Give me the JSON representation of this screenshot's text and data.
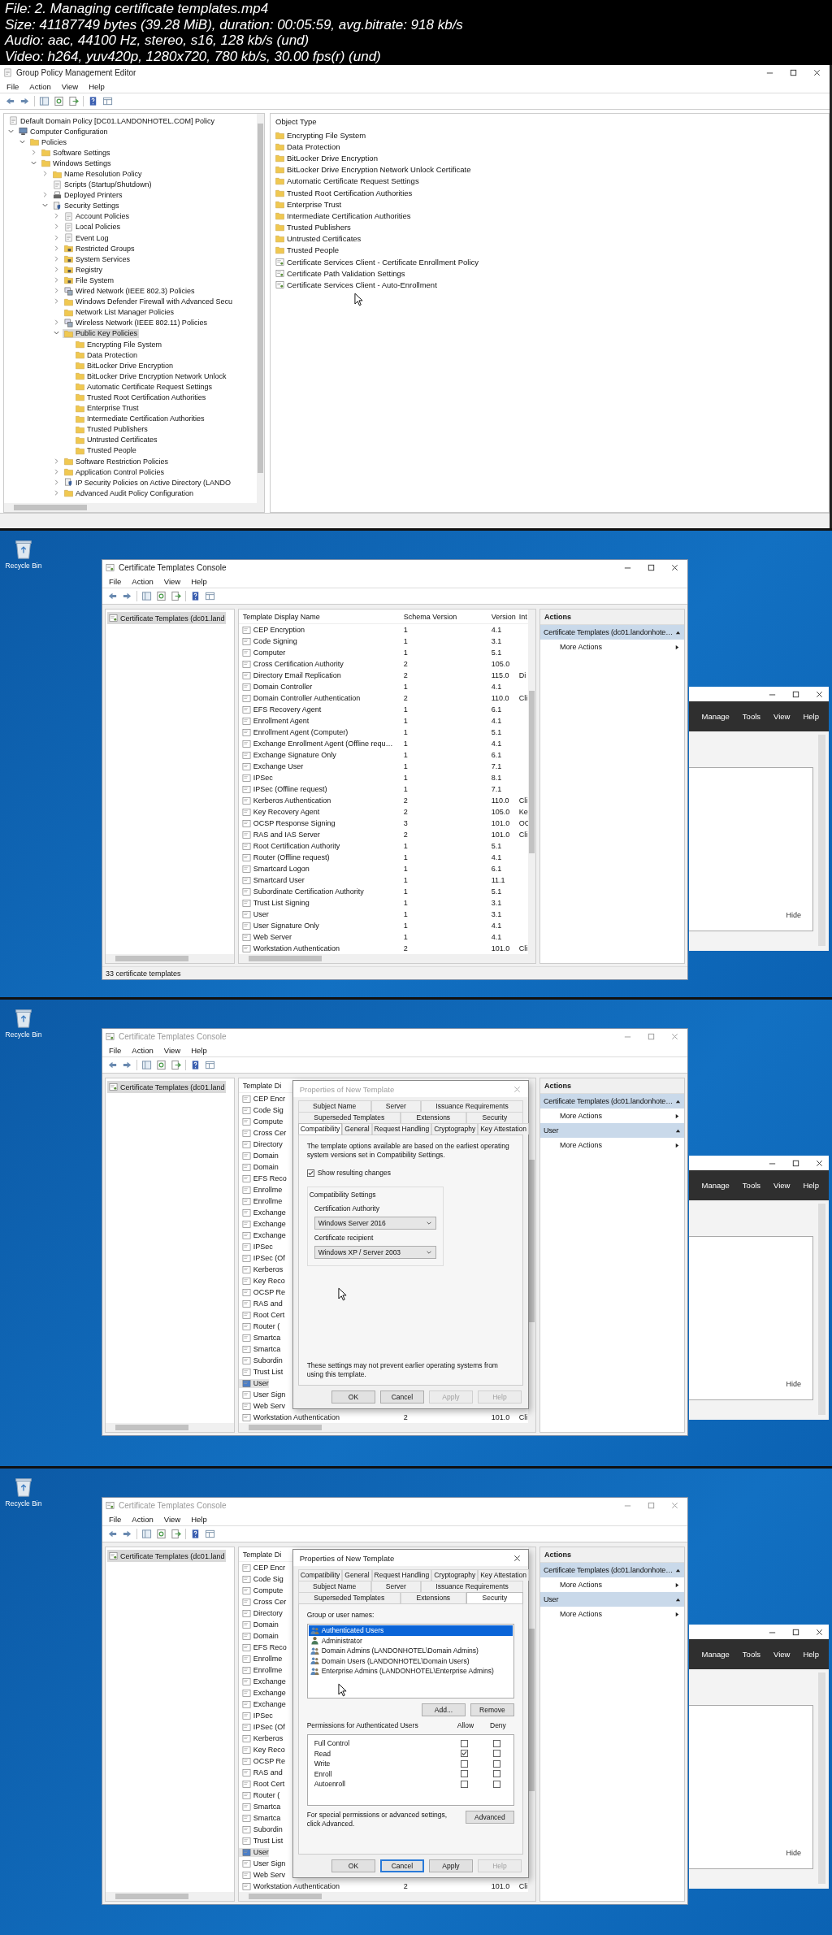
{
  "header": {
    "lines": [
      "File: 2. Managing certificate templates.mp4",
      "Size: 41187749 bytes (39.28 MiB), duration: 00:05:59, avg.bitrate: 918 kb/s",
      "Audio: aac, 44100 Hz, stereo, s16, 128 kb/s (und)",
      "Video: h264, yuv420p, 1280x720, 780 kb/s, 30.00 fps(r) (und)"
    ]
  },
  "frames": [
    {
      "kind": "gpme",
      "window": {
        "title": "Group Policy Management Editor"
      },
      "menu": [
        "File",
        "Action",
        "View",
        "Help"
      ],
      "tree": {
        "label": "Default Domain Policy [DC01.LANDONHOTEL.COM] Policy",
        "kind": "document",
        "selected": false,
        "children": [
          {
            "label": "Computer Configuration",
            "kind": "computer",
            "selected": false,
            "expanded": true,
            "children": [
              {
                "label": "Policies",
                "kind": "folder",
                "selected": false,
                "expanded": true,
                "children": [
                  {
                    "label": "Software Settings",
                    "kind": "folder",
                    "selected": false,
                    "expanded": false
                  },
                  {
                    "label": "Windows Settings",
                    "kind": "folder",
                    "selected": false,
                    "expanded": true,
                    "children": [
                      {
                        "label": "Name Resolution Policy",
                        "kind": "folder",
                        "selected": false,
                        "expanded": false
                      },
                      {
                        "label": "Scripts (Startup/Shutdown)",
                        "kind": "document",
                        "selected": false
                      },
                      {
                        "label": "Deployed Printers",
                        "kind": "printer",
                        "selected": false,
                        "expanded": false
                      },
                      {
                        "label": "Security Settings",
                        "kind": "security",
                        "selected": false,
                        "expanded": true,
                        "children": [
                          {
                            "label": "Account Policies",
                            "kind": "document",
                            "selected": false,
                            "expanded": false
                          },
                          {
                            "label": "Local Policies",
                            "kind": "document",
                            "selected": false,
                            "expanded": false
                          },
                          {
                            "label": "Event Log",
                            "kind": "document",
                            "selected": false,
                            "expanded": false
                          },
                          {
                            "label": "Restricted Groups",
                            "kind": "locked_folder",
                            "selected": false,
                            "expanded": false
                          },
                          {
                            "label": "System Services",
                            "kind": "locked_folder",
                            "selected": false,
                            "expanded": false
                          },
                          {
                            "label": "Registry",
                            "kind": "locked_folder",
                            "selected": false,
                            "expanded": false
                          },
                          {
                            "label": "File System",
                            "kind": "locked_folder",
                            "selected": false,
                            "expanded": false
                          },
                          {
                            "label": "Wired Network (IEEE 802.3) Policies",
                            "kind": "network",
                            "selected": false,
                            "expanded": false
                          },
                          {
                            "label": "Windows Defender Firewall with Advanced Secu",
                            "kind": "folder",
                            "selected": false,
                            "expanded": false
                          },
                          {
                            "label": "Network List Manager Policies",
                            "kind": "folder",
                            "selected": false
                          },
                          {
                            "label": "Wireless Network (IEEE 802.11) Policies",
                            "kind": "network",
                            "selected": false,
                            "expanded": false
                          },
                          {
                            "label": "Public Key Policies",
                            "kind": "folder",
                            "selected": true,
                            "expanded": true,
                            "children": [
                              {
                                "label": "Encrypting File System",
                                "kind": "folder",
                                "selected": false
                              },
                              {
                                "label": "Data Protection",
                                "kind": "folder",
                                "selected": false
                              },
                              {
                                "label": "BitLocker Drive Encryption",
                                "kind": "folder",
                                "selected": false
                              },
                              {
                                "label": "BitLocker Drive Encryption Network Unlock",
                                "kind": "folder",
                                "selected": false
                              },
                              {
                                "label": "Automatic Certificate Request Settings",
                                "kind": "folder",
                                "selected": false
                              },
                              {
                                "label": "Trusted Root Certification Authorities",
                                "kind": "folder",
                                "selected": false
                              },
                              {
                                "label": "Enterprise Trust",
                                "kind": "folder",
                                "selected": false
                              },
                              {
                                "label": "Intermediate Certification Authorities",
                                "kind": "folder",
                                "selected": false
                              },
                              {
                                "label": "Trusted Publishers",
                                "kind": "folder",
                                "selected": false
                              },
                              {
                                "label": "Untrusted Certificates",
                                "kind": "folder",
                                "selected": false
                              },
                              {
                                "label": "Trusted People",
                                "kind": "folder",
                                "selected": false
                              }
                            ]
                          },
                          {
                            "label": "Software Restriction Policies",
                            "kind": "folder",
                            "selected": false,
                            "expanded": false
                          },
                          {
                            "label": "Application Control Policies",
                            "kind": "folder",
                            "selected": false,
                            "expanded": false
                          },
                          {
                            "label": "IP Security Policies on Active Directory (LANDO",
                            "kind": "security",
                            "selected": false,
                            "expanded": false
                          },
                          {
                            "label": "Advanced Audit Policy Configuration",
                            "kind": "folder",
                            "selected": false,
                            "expanded": false
                          }
                        ]
                      }
                    ]
                  }
                ]
              }
            ]
          }
        ]
      },
      "list": {
        "header": "Object Type",
        "items": [
          {
            "label": "Encrypting File System",
            "kind": "folder"
          },
          {
            "label": "Data Protection",
            "kind": "folder"
          },
          {
            "label": "BitLocker Drive Encryption",
            "kind": "folder"
          },
          {
            "label": "BitLocker Drive Encryption Network Unlock Certificate",
            "kind": "folder"
          },
          {
            "label": "Automatic Certificate Request Settings",
            "kind": "folder"
          },
          {
            "label": "Trusted Root Certification Authorities",
            "kind": "folder"
          },
          {
            "label": "Enterprise Trust",
            "kind": "folder"
          },
          {
            "label": "Intermediate Certification Authorities",
            "kind": "folder"
          },
          {
            "label": "Trusted Publishers",
            "kind": "folder"
          },
          {
            "label": "Untrusted Certificates",
            "kind": "folder"
          },
          {
            "label": "Trusted People",
            "kind": "folder"
          },
          {
            "label": "Certificate Services Client - Certificate Enrollment Policy",
            "kind": "certificate"
          },
          {
            "label": "Certificate Path Validation Settings",
            "kind": "certificate"
          },
          {
            "label": "Certificate Services Client - Auto-Enrollment",
            "kind": "certificate"
          }
        ]
      }
    },
    {
      "kind": "console",
      "recycle_bin": "Recycle Bin",
      "window": {
        "title": "Certificate Templates Console",
        "active": true
      },
      "menu": [
        "File",
        "Action",
        "View",
        "Help"
      ],
      "tree_item": {
        "label": "Certificate Templates (dc01.land",
        "selected": true
      },
      "list": {
        "columns": [
          "Template Display Name",
          "Schema Version",
          "Version",
          "Int"
        ],
        "rows": [
          {
            "cells": [
              "CEP Encryption",
              "1",
              "4.1"
            ],
            "selected": false
          },
          {
            "cells": [
              "Code Signing",
              "1",
              "3.1"
            ],
            "selected": false
          },
          {
            "cells": [
              "Computer",
              "1",
              "5.1"
            ],
            "selected": false
          },
          {
            "cells": [
              "Cross Certification Authority",
              "2",
              "105.0"
            ],
            "selected": false
          },
          {
            "cells": [
              "Directory Email Replication",
              "2",
              "115.0",
              "Di"
            ],
            "selected": false
          },
          {
            "cells": [
              "Domain Controller",
              "1",
              "4.1"
            ],
            "selected": false
          },
          {
            "cells": [
              "Domain Controller Authentication",
              "2",
              "110.0",
              "Cli"
            ],
            "selected": false
          },
          {
            "cells": [
              "EFS Recovery Agent",
              "1",
              "6.1"
            ],
            "selected": false
          },
          {
            "cells": [
              "Enrollment Agent",
              "1",
              "4.1"
            ],
            "selected": false
          },
          {
            "cells": [
              "Enrollment Agent (Computer)",
              "1",
              "5.1"
            ],
            "selected": false
          },
          {
            "cells": [
              "Exchange Enrollment Agent (Offline requ…",
              "1",
              "4.1"
            ],
            "selected": false
          },
          {
            "cells": [
              "Exchange Signature Only",
              "1",
              "6.1"
            ],
            "selected": false
          },
          {
            "cells": [
              "Exchange User",
              "1",
              "7.1"
            ],
            "selected": false
          },
          {
            "cells": [
              "IPSec",
              "1",
              "8.1"
            ],
            "selected": false
          },
          {
            "cells": [
              "IPSec (Offline request)",
              "1",
              "7.1"
            ],
            "selected": false
          },
          {
            "cells": [
              "Kerberos Authentication",
              "2",
              "110.0",
              "Cli"
            ],
            "selected": false
          },
          {
            "cells": [
              "Key Recovery Agent",
              "2",
              "105.0",
              "Ke"
            ],
            "selected": false
          },
          {
            "cells": [
              "OCSP Response Signing",
              "3",
              "101.0",
              "OC"
            ],
            "selected": false
          },
          {
            "cells": [
              "RAS and IAS Server",
              "2",
              "101.0",
              "Cli"
            ],
            "selected": false
          },
          {
            "cells": [
              "Root Certification Authority",
              "1",
              "5.1"
            ],
            "selected": false
          },
          {
            "cells": [
              "Router (Offline request)",
              "1",
              "4.1"
            ],
            "selected": false
          },
          {
            "cells": [
              "Smartcard Logon",
              "1",
              "6.1"
            ],
            "selected": false
          },
          {
            "cells": [
              "Smartcard User",
              "1",
              "11.1"
            ],
            "selected": false
          },
          {
            "cells": [
              "Subordinate Certification Authority",
              "1",
              "5.1"
            ],
            "selected": false
          },
          {
            "cells": [
              "Trust List Signing",
              "1",
              "3.1"
            ],
            "selected": false
          },
          {
            "cells": [
              "User",
              "1",
              "3.1"
            ],
            "selected": false
          },
          {
            "cells": [
              "User Signature Only",
              "1",
              "4.1"
            ],
            "selected": false
          },
          {
            "cells": [
              "Web Server",
              "1",
              "4.1"
            ],
            "selected": false
          },
          {
            "cells": [
              "Workstation Authentication",
              "2",
              "101.0",
              "Cli"
            ],
            "selected": false
          }
        ]
      },
      "actions": {
        "title": "Actions",
        "sections": [
          {
            "title": "Certificate Templates (dc01.landonhote…",
            "items": [
              "More Actions"
            ]
          }
        ]
      },
      "status": "33 certificate templates",
      "background_window": {
        "menu": [
          "Manage",
          "Tools",
          "View",
          "Help"
        ],
        "link": "Hide"
      }
    },
    {
      "kind": "console",
      "recycle_bin": "Recycle Bin",
      "window": {
        "title": "Certificate Templates Console",
        "active": false
      },
      "menu": [
        "File",
        "Action",
        "View",
        "Help"
      ],
      "tree_item": {
        "label": "Certificate Templates (dc01.land",
        "selected": true
      },
      "list": {
        "columns": [
          "Template Di"
        ],
        "rows": [
          {
            "cells": [
              "CEP Encr"
            ],
            "selected": false
          },
          {
            "cells": [
              "Code Sig"
            ],
            "selected": false
          },
          {
            "cells": [
              "Compute"
            ],
            "selected": false
          },
          {
            "cells": [
              "Cross Cer"
            ],
            "selected": false
          },
          {
            "cells": [
              "Directory"
            ],
            "selected": false
          },
          {
            "cells": [
              "Domain"
            ],
            "selected": false
          },
          {
            "cells": [
              "Domain"
            ],
            "selected": false
          },
          {
            "cells": [
              "EFS Reco"
            ],
            "selected": false
          },
          {
            "cells": [
              "Enrollme"
            ],
            "selected": false
          },
          {
            "cells": [
              "Enrollme"
            ],
            "selected": false
          },
          {
            "cells": [
              "Exchange"
            ],
            "selected": false
          },
          {
            "cells": [
              "Exchange"
            ],
            "selected": false
          },
          {
            "cells": [
              "Exchange"
            ],
            "selected": false
          },
          {
            "cells": [
              "IPSec"
            ],
            "selected": false
          },
          {
            "cells": [
              "IPSec (Of"
            ],
            "selected": false
          },
          {
            "cells": [
              "Kerberos"
            ],
            "selected": false
          },
          {
            "cells": [
              "Key Reco"
            ],
            "selected": false
          },
          {
            "cells": [
              "OCSP Re"
            ],
            "selected": false
          },
          {
            "cells": [
              "RAS and"
            ],
            "selected": false
          },
          {
            "cells": [
              "Root Cert"
            ],
            "selected": false
          },
          {
            "cells": [
              "Router ("
            ],
            "selected": false
          },
          {
            "cells": [
              "Smartca"
            ],
            "selected": false
          },
          {
            "cells": [
              "Smartca"
            ],
            "selected": false
          },
          {
            "cells": [
              "Subordin"
            ],
            "selected": false
          },
          {
            "cells": [
              "Trust List"
            ],
            "selected": false
          },
          {
            "cells": [
              "User"
            ],
            "selected": true
          },
          {
            "cells": [
              "User Sign"
            ],
            "selected": false
          },
          {
            "cells": [
              "Web Serv"
            ],
            "selected": false
          },
          {
            "cells": [
              "Workstation Authentication",
              "2",
              "101.0",
              "Cli"
            ],
            "selected": false
          }
        ]
      },
      "actions": {
        "title": "Actions",
        "sections": [
          {
            "title": "Certificate Templates (dc01.landonhote…",
            "items": [
              "More Actions"
            ]
          },
          {
            "title": "User",
            "items": [
              "More Actions"
            ]
          }
        ]
      },
      "background_window": {
        "menu": [
          "Manage",
          "Tools",
          "View",
          "Help"
        ],
        "link": "Hide"
      },
      "dialog": {
        "kind": "compatibility",
        "title": "Properties of New Template",
        "active": false,
        "tab_rows": [
          [
            {
              "label": "Subject Name",
              "selected": false
            },
            {
              "label": "Server",
              "selected": false
            },
            {
              "label": "Issuance Requirements",
              "selected": false
            }
          ],
          [
            {
              "label": "Superseded Templates",
              "selected": false
            },
            {
              "label": "Extensions",
              "selected": false
            },
            {
              "label": "Security",
              "selected": false
            }
          ],
          [
            {
              "label": "Compatibility",
              "selected": true
            },
            {
              "label": "General",
              "selected": false
            },
            {
              "label": "Request Handling",
              "selected": false
            },
            {
              "label": "Cryptography",
              "selected": false
            },
            {
              "label": "Key Attestation",
              "selected": false
            }
          ]
        ],
        "intro": "The template options available are based on the earliest operating system versions set in Compatibility Settings.",
        "show_changes": {
          "label": "Show resulting changes",
          "checked": true
        },
        "group": "Compatibility Settings",
        "fields": [
          {
            "label": "Certification Authority",
            "value": "Windows Server 2016"
          },
          {
            "label": "Certificate recipient",
            "value": "Windows XP / Server 2003"
          }
        ],
        "note": "These settings may not prevent earlier operating systems from using this template.",
        "buttons": [
          {
            "label": "OK",
            "disabled": false,
            "focused": false
          },
          {
            "label": "Cancel",
            "disabled": false,
            "focused": false
          },
          {
            "label": "Apply",
            "disabled": true,
            "focused": false
          },
          {
            "label": "Help",
            "disabled": true,
            "focused": false
          }
        ]
      }
    },
    {
      "kind": "console",
      "recycle_bin": "Recycle Bin",
      "window": {
        "title": "Certificate Templates Console",
        "active": false
      },
      "menu": [
        "File",
        "Action",
        "View",
        "Help"
      ],
      "tree_item": {
        "label": "Certificate Templates (dc01.land",
        "selected": true
      },
      "list": {
        "columns": [
          "Template Di"
        ],
        "rows": [
          {
            "cells": [
              "CEP Encr"
            ],
            "selected": false
          },
          {
            "cells": [
              "Code Sig"
            ],
            "selected": false
          },
          {
            "cells": [
              "Compute"
            ],
            "selected": false
          },
          {
            "cells": [
              "Cross Cer"
            ],
            "selected": false
          },
          {
            "cells": [
              "Directory"
            ],
            "selected": false
          },
          {
            "cells": [
              "Domain"
            ],
            "selected": false
          },
          {
            "cells": [
              "Domain"
            ],
            "selected": false
          },
          {
            "cells": [
              "EFS Reco"
            ],
            "selected": false
          },
          {
            "cells": [
              "Enrollme"
            ],
            "selected": false
          },
          {
            "cells": [
              "Enrollme"
            ],
            "selected": false
          },
          {
            "cells": [
              "Exchange"
            ],
            "selected": false
          },
          {
            "cells": [
              "Exchange"
            ],
            "selected": false
          },
          {
            "cells": [
              "Exchange"
            ],
            "selected": false
          },
          {
            "cells": [
              "IPSec"
            ],
            "selected": false
          },
          {
            "cells": [
              "IPSec (Of"
            ],
            "selected": false
          },
          {
            "cells": [
              "Kerberos"
            ],
            "selected": false
          },
          {
            "cells": [
              "Key Reco"
            ],
            "selected": false
          },
          {
            "cells": [
              "OCSP Re"
            ],
            "selected": false
          },
          {
            "cells": [
              "RAS and"
            ],
            "selected": false
          },
          {
            "cells": [
              "Root Cert"
            ],
            "selected": false
          },
          {
            "cells": [
              "Router ("
            ],
            "selected": false
          },
          {
            "cells": [
              "Smartca"
            ],
            "selected": false
          },
          {
            "cells": [
              "Smartca"
            ],
            "selected": false
          },
          {
            "cells": [
              "Subordin"
            ],
            "selected": false
          },
          {
            "cells": [
              "Trust List"
            ],
            "selected": false
          },
          {
            "cells": [
              "User"
            ],
            "selected": true
          },
          {
            "cells": [
              "User Sign"
            ],
            "selected": false
          },
          {
            "cells": [
              "Web Serv"
            ],
            "selected": false
          },
          {
            "cells": [
              "Workstation Authentication",
              "2",
              "101.0",
              "Cli"
            ],
            "selected": false
          }
        ]
      },
      "actions": {
        "title": "Actions",
        "sections": [
          {
            "title": "Certificate Templates (dc01.landonhote…",
            "items": [
              "More Actions"
            ]
          },
          {
            "title": "User",
            "items": [
              "More Actions"
            ]
          }
        ]
      },
      "background_window": {
        "menu": [
          "Manage",
          "Tools",
          "View",
          "Help"
        ],
        "link": "Hide"
      },
      "dialog": {
        "kind": "security",
        "title": "Properties of New Template",
        "active": true,
        "tab_rows": [
          [
            {
              "label": "Compatibility",
              "selected": false
            },
            {
              "label": "General",
              "selected": false
            },
            {
              "label": "Request Handling",
              "selected": false
            },
            {
              "label": "Cryptography",
              "selected": false
            },
            {
              "label": "Key Attestation",
              "selected": false
            }
          ],
          [
            {
              "label": "Subject Name",
              "selected": false
            },
            {
              "label": "Server",
              "selected": false
            },
            {
              "label": "Issuance Requirements",
              "selected": false
            }
          ],
          [
            {
              "label": "Superseded Templates",
              "selected": false
            },
            {
              "label": "Extensions",
              "selected": false
            },
            {
              "label": "Security",
              "selected": true
            }
          ]
        ],
        "group_label": "Group or user names:",
        "principals": [
          {
            "label": "Authenticated Users",
            "kind": "group",
            "selected": true
          },
          {
            "label": "Administrator",
            "kind": "user",
            "selected": false
          },
          {
            "label": "Domain Admins (LANDONHOTEL\\Domain Admins)",
            "kind": "group",
            "selected": false
          },
          {
            "label": "Domain Users (LANDONHOTEL\\Domain Users)",
            "kind": "group",
            "selected": false
          },
          {
            "label": "Enterprise Admins (LANDONHOTEL\\Enterprise Admins)",
            "kind": "group",
            "selected": false
          }
        ],
        "principal_buttons": [
          "Add...",
          "Remove"
        ],
        "permissions": {
          "title": "Permissions for Authenticated Users",
          "columns": [
            "Allow",
            "Deny"
          ],
          "rows": [
            {
              "label": "Full Control",
              "allow": false,
              "deny": false
            },
            {
              "label": "Read",
              "allow": true,
              "deny": false
            },
            {
              "label": "Write",
              "allow": false,
              "deny": false
            },
            {
              "label": "Enroll",
              "allow": false,
              "deny": false
            },
            {
              "label": "Autoenroll",
              "allow": false,
              "deny": false
            }
          ]
        },
        "advanced_note": "For special permissions or advanced settings, click Advanced.",
        "advanced_button": "Advanced",
        "buttons": [
          {
            "label": "OK",
            "disabled": false,
            "focused": false
          },
          {
            "label": "Cancel",
            "disabled": false,
            "focused": true
          },
          {
            "label": "Apply",
            "disabled": false,
            "focused": false
          },
          {
            "label": "Help",
            "disabled": true,
            "focused": false
          }
        ]
      }
    }
  ]
}
